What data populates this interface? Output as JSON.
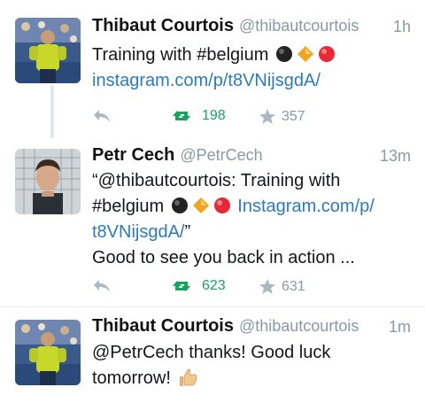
{
  "tweets": [
    {
      "name": "Thibaut Courtois",
      "handle": "@thibautcourtois",
      "time": "1h",
      "text_before": "Training with #belgium",
      "text_link": "instagram.com/p/t8VNijsgdA/",
      "retweets": "198",
      "favorites": "357"
    },
    {
      "name": "Petr Cech",
      "handle": "@PetrCech",
      "time": "13m",
      "line1": "“@thibautcourtois: Training with",
      "line2_text": "#belgium",
      "line2_link": "Instagram.com/p/",
      "line3_link": "t8VNijsgdA/",
      "line3_rest": "”",
      "line4": "Good to see you back in action ...",
      "retweets": "623",
      "favorites": "631"
    },
    {
      "name": "Thibaut Courtois",
      "handle": "@thibautcourtois",
      "time": "1m",
      "line1": "@PetrCech thanks! Good luck",
      "line2": "tomorrow!"
    }
  ],
  "colors": {
    "link": "#2b7bb9",
    "retweet": "#19a45e",
    "meta": "#8899a6"
  },
  "icons": [
    "reply-icon",
    "retweet-icon",
    "favorite-star-icon",
    "black-circle-emoji",
    "orange-diamond-emoji",
    "red-circle-emoji",
    "thumbs-up-emoji"
  ]
}
